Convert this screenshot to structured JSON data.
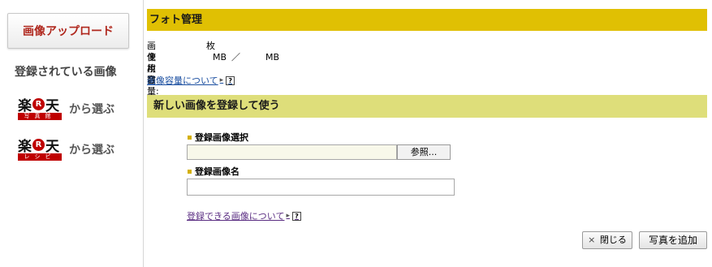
{
  "sidebar": {
    "upload_tab": "画像アップロード",
    "registered_link": "登録されている画像",
    "rakuten_items": [
      {
        "logo_chars": [
          "楽",
          "R",
          "天"
        ],
        "logo_sub": "写真館",
        "choose_label": "から選ぶ"
      },
      {
        "logo_chars": [
          "楽",
          "R",
          "天"
        ],
        "logo_sub": "レシピ",
        "choose_label": "から選ぶ"
      }
    ]
  },
  "header": {
    "title": "フォト管理"
  },
  "stats": {
    "count_label": "画像枚数:",
    "count_unit": "枚",
    "usage_label": "使用容量:",
    "used_unit": "MB",
    "separator": "／",
    "total_unit": "MB"
  },
  "links": {
    "capacity": "画像容量について",
    "registrable": "登録できる画像について"
  },
  "section": {
    "title": "新しい画像を登録して使う"
  },
  "form": {
    "select_label": "登録画像選択",
    "browse_button": "参照...",
    "name_label": "登録画像名",
    "name_value": ""
  },
  "buttons": {
    "close": "閉じる",
    "add": "写真を追加"
  },
  "icons": {
    "help": "?",
    "close_x": "×"
  },
  "colors": {
    "header_bar": "#e0c003",
    "section_bar": "#dede7a",
    "rakuten_red": "#bf0000",
    "upload_tab_text": "#b0281e"
  }
}
